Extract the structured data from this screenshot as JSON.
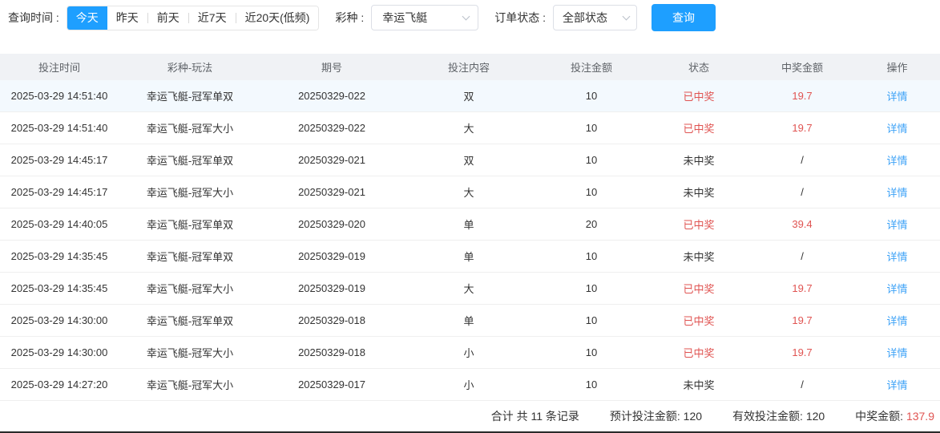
{
  "colors": {
    "accent": "#1e9fff",
    "win_red": "#e05452",
    "link_blue": "#3fa3f7"
  },
  "filters": {
    "time_label": "查询时间 :",
    "time_options": [
      {
        "label": "今天",
        "active": true
      },
      {
        "label": "昨天",
        "active": false
      },
      {
        "label": "前天",
        "active": false
      },
      {
        "label": "近7天",
        "active": false
      },
      {
        "label": "近20天(低频)",
        "active": false
      }
    ],
    "lottery_label": "彩种 :",
    "lottery_value": "幸运飞艇",
    "status_label": "订单状态 :",
    "status_value": "全部状态",
    "search_label": "查询"
  },
  "table": {
    "columns": [
      "投注时间",
      "彩种-玩法",
      "期号",
      "投注内容",
      "投注金额",
      "状态",
      "中奖金额",
      "操作"
    ],
    "action_label": "详情",
    "rows": [
      {
        "time": "2025-03-29 14:51:40",
        "game": "幸运飞艇-冠军单双",
        "issue": "20250329-022",
        "content": "双",
        "amount": "10",
        "status": "已中奖",
        "prize": "19.7",
        "won": true,
        "highlight": true
      },
      {
        "time": "2025-03-29 14:51:40",
        "game": "幸运飞艇-冠军大小",
        "issue": "20250329-022",
        "content": "大",
        "amount": "10",
        "status": "已中奖",
        "prize": "19.7",
        "won": true,
        "highlight": false
      },
      {
        "time": "2025-03-29 14:45:17",
        "game": "幸运飞艇-冠军单双",
        "issue": "20250329-021",
        "content": "双",
        "amount": "10",
        "status": "未中奖",
        "prize": "/",
        "won": false,
        "highlight": false
      },
      {
        "time": "2025-03-29 14:45:17",
        "game": "幸运飞艇-冠军大小",
        "issue": "20250329-021",
        "content": "大",
        "amount": "10",
        "status": "未中奖",
        "prize": "/",
        "won": false,
        "highlight": false
      },
      {
        "time": "2025-03-29 14:40:05",
        "game": "幸运飞艇-冠军单双",
        "issue": "20250329-020",
        "content": "单",
        "amount": "20",
        "status": "已中奖",
        "prize": "39.4",
        "won": true,
        "highlight": false
      },
      {
        "time": "2025-03-29 14:35:45",
        "game": "幸运飞艇-冠军单双",
        "issue": "20250329-019",
        "content": "单",
        "amount": "10",
        "status": "未中奖",
        "prize": "/",
        "won": false,
        "highlight": false
      },
      {
        "time": "2025-03-29 14:35:45",
        "game": "幸运飞艇-冠军大小",
        "issue": "20250329-019",
        "content": "大",
        "amount": "10",
        "status": "已中奖",
        "prize": "19.7",
        "won": true,
        "highlight": false
      },
      {
        "time": "2025-03-29 14:30:00",
        "game": "幸运飞艇-冠军单双",
        "issue": "20250329-018",
        "content": "单",
        "amount": "10",
        "status": "已中奖",
        "prize": "19.7",
        "won": true,
        "highlight": false
      },
      {
        "time": "2025-03-29 14:30:00",
        "game": "幸运飞艇-冠军大小",
        "issue": "20250329-018",
        "content": "小",
        "amount": "10",
        "status": "已中奖",
        "prize": "19.7",
        "won": true,
        "highlight": false
      },
      {
        "time": "2025-03-29 14:27:20",
        "game": "幸运飞艇-冠军大小",
        "issue": "20250329-017",
        "content": "小",
        "amount": "10",
        "status": "未中奖",
        "prize": "/",
        "won": false,
        "highlight": false
      }
    ]
  },
  "footer": {
    "total_text": "合计 共 11 条记录",
    "expected_label": "预计投注金额:",
    "expected_value": "120",
    "valid_label": "有效投注金额:",
    "valid_value": "120",
    "prize_label": "中奖金额:",
    "prize_value": "137.9"
  }
}
